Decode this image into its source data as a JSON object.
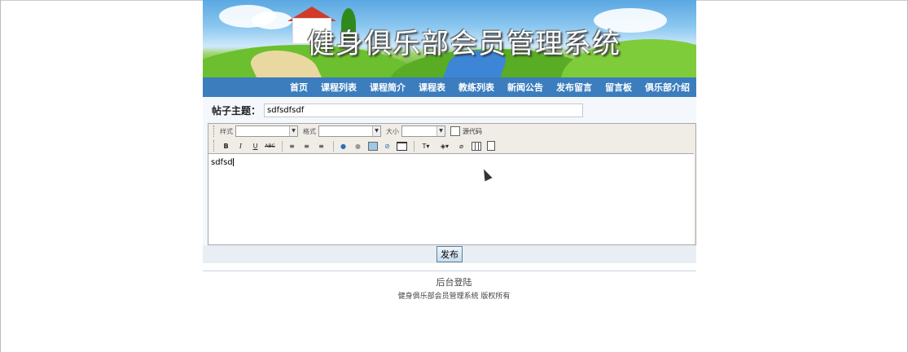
{
  "banner": {
    "title": "健身俱乐部会员管理系统"
  },
  "nav": {
    "items": [
      "首页",
      "课程列表",
      "课程简介",
      "课程表",
      "教练列表",
      "新闻公告",
      "发布留言",
      "留言板",
      "俱乐部介绍"
    ]
  },
  "form": {
    "subject_label": "帖子主题：",
    "subject_value": "sdfsdfsdf",
    "editor": {
      "style_label": "样式",
      "format_label": "格式",
      "size_label": "大小",
      "source_label": "源代码",
      "content": "sdfsd"
    },
    "submit_label": "发布"
  },
  "footer": {
    "admin_link": "后台登陆",
    "copyright": "健身俱乐部会员管理系统  版权所有"
  },
  "colors": {
    "nav_bg": "#3b7dbd",
    "form_bg": "#f4f8fc"
  }
}
